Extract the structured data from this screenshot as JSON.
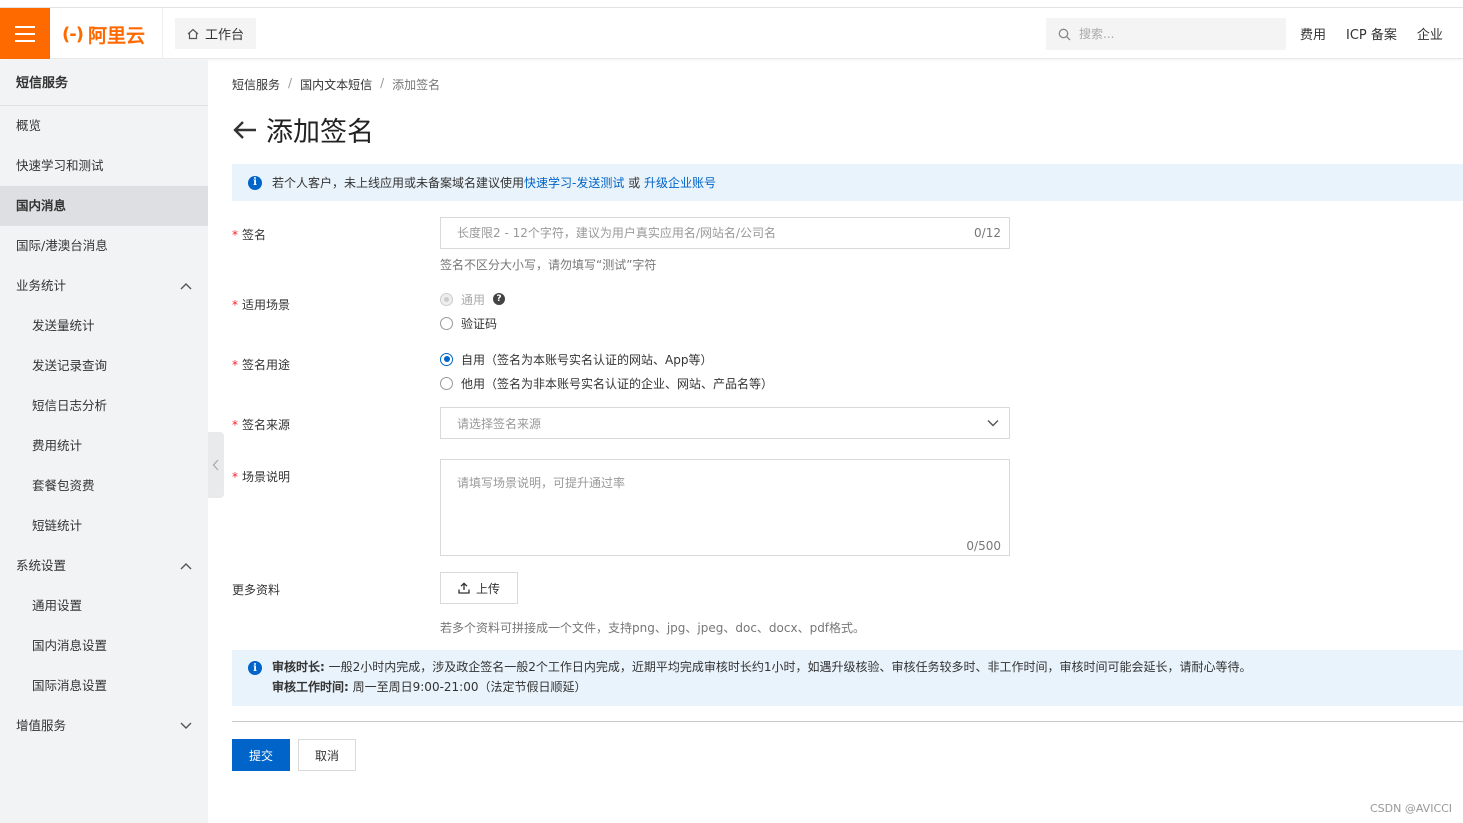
{
  "header": {
    "brand": "阿里云",
    "brand_mark": "(-)",
    "workbench_label": "工作台",
    "search_placeholder": "搜索...",
    "links": [
      "费用",
      "ICP 备案",
      "企业"
    ]
  },
  "sidebar": {
    "title": "短信服务",
    "items": [
      {
        "label": "概览",
        "level": 1
      },
      {
        "label": "快速学习和测试",
        "level": 1
      },
      {
        "label": "国内消息",
        "level": 1,
        "active": true
      },
      {
        "label": "国际/港澳台消息",
        "level": 1
      },
      {
        "label": "业务统计",
        "level": 1,
        "expanded": true
      },
      {
        "label": "发送量统计",
        "level": 2
      },
      {
        "label": "发送记录查询",
        "level": 2
      },
      {
        "label": "短信日志分析",
        "level": 2
      },
      {
        "label": "费用统计",
        "level": 2
      },
      {
        "label": "套餐包资费",
        "level": 2
      },
      {
        "label": "短链统计",
        "level": 2
      },
      {
        "label": "系统设置",
        "level": 1,
        "expanded": true
      },
      {
        "label": "通用设置",
        "level": 2
      },
      {
        "label": "国内消息设置",
        "level": 2
      },
      {
        "label": "国际消息设置",
        "level": 2
      },
      {
        "label": "增值服务",
        "level": 1,
        "expanded": false
      }
    ]
  },
  "breadcrumb": [
    "短信服务",
    "国内文本短信",
    "添加签名"
  ],
  "page_title": "添加签名",
  "notice1": {
    "text": "若个人客户，未上线应用或未备案域名建议使用",
    "link1": "快速学习-发送测试",
    "or": " 或 ",
    "link2": "升级企业账号"
  },
  "form": {
    "signature": {
      "label": "签名",
      "placeholder": "长度限2 - 12个字符，建议为用户真实应用名/网站名/公司名",
      "counter": "0/12",
      "hint": "签名不区分大小写，请勿填写“测试”字符"
    },
    "scene": {
      "label": "适用场景",
      "options": [
        "通用",
        "验证码"
      ]
    },
    "purpose": {
      "label": "签名用途",
      "options": [
        "自用（签名为本账号实名认证的网站、App等）",
        "他用（签名为非本账号实名认证的企业、网站、产品名等）"
      ]
    },
    "source": {
      "label": "签名来源",
      "placeholder": "请选择签名来源"
    },
    "scene_desc": {
      "label": "场景说明",
      "placeholder": "请填写场景说明，可提升通过率",
      "counter": "0/500"
    },
    "more": {
      "label": "更多资料",
      "upload_label": "上传",
      "hint": "若多个资料可拼接成一个文件，支持png、jpg、jpeg、doc、docx、pdf格式。"
    }
  },
  "notice2": {
    "line1_bold": "审核时长:",
    "line1": " 一般2小时内完成，涉及政企签名一般2个工作日内完成，近期平均完成审核时长约1小时，如遇升级核验、审核任务较多时、非工作时间，审核时间可能会延长，请耐心等待。",
    "line2_bold": "审核工作时间:",
    "line2": " 周一至周日9:00-21:00（法定节假日顺延）"
  },
  "buttons": {
    "submit": "提交",
    "cancel": "取消"
  },
  "watermark": "CSDN @AVICCI",
  "colors": {
    "brand": "#ff6a00",
    "primary": "#0064c8",
    "required": "#f5222d"
  }
}
